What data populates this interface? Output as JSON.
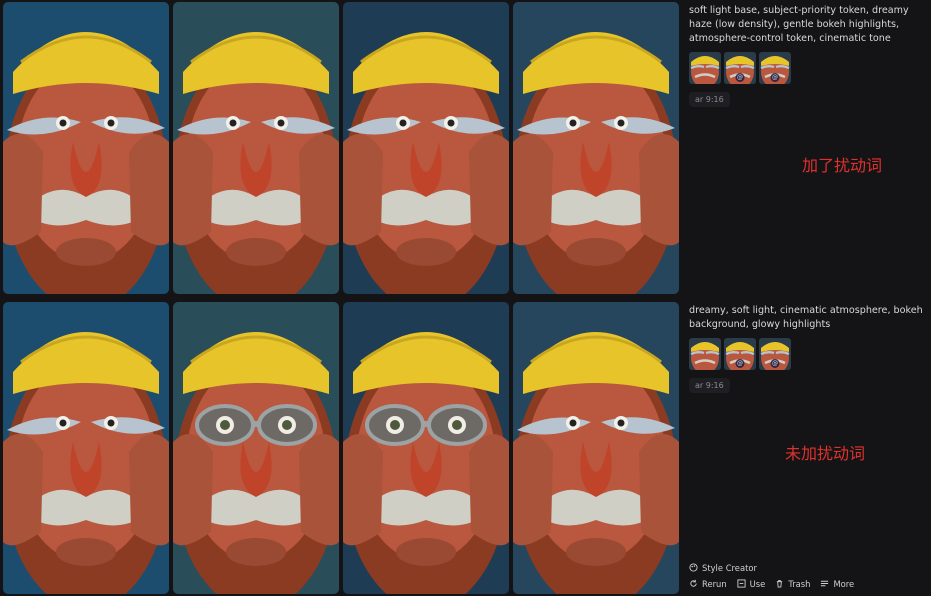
{
  "rows": [
    {
      "prompt": "soft light base, subject-priority token, dreamy haze (low density), gentle bokeh highlights, atmosphere-control token, cinematic tone",
      "aspect": "ar 9:16",
      "annotation": "加了扰动词"
    },
    {
      "prompt": "dreamy, soft light, cinematic atmosphere, bokeh background, glowy highlights",
      "aspect": "ar 9:16",
      "annotation": "未加扰动词"
    }
  ],
  "actions": {
    "style_creator": "Style Creator",
    "rerun": "Rerun",
    "use": "Use",
    "trash": "Trash",
    "more": "More"
  },
  "icons": {
    "style_creator": "palette-icon",
    "rerun": "refresh-icon",
    "use": "use-icon",
    "trash": "trash-icon",
    "more": "menu-icon"
  },
  "colors": {
    "background": "#141416",
    "annotation": "#e0312d",
    "cap": "#e7c52a",
    "skin": "#b9583e",
    "mustache": "#cfcfc6"
  }
}
